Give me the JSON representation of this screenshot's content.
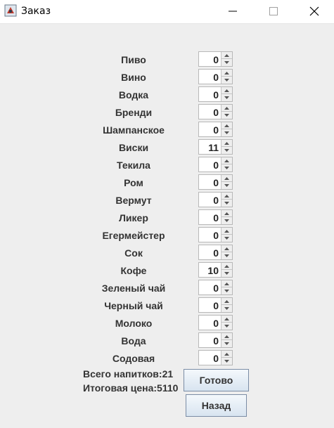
{
  "window": {
    "title": "Заказ"
  },
  "drinks": [
    {
      "label": "Пиво",
      "value": "0"
    },
    {
      "label": "Вино",
      "value": "0"
    },
    {
      "label": "Водка",
      "value": "0"
    },
    {
      "label": "Бренди",
      "value": "0"
    },
    {
      "label": "Шампанское",
      "value": "0"
    },
    {
      "label": "Виски",
      "value": "11"
    },
    {
      "label": "Текила",
      "value": "0"
    },
    {
      "label": "Ром",
      "value": "0"
    },
    {
      "label": "Вермут",
      "value": "0"
    },
    {
      "label": "Ликер",
      "value": "0"
    },
    {
      "label": "Егермейстер",
      "value": "0"
    },
    {
      "label": "Сок",
      "value": "0"
    },
    {
      "label": "Кофе",
      "value": "10"
    },
    {
      "label": "Зеленый чай",
      "value": "0"
    },
    {
      "label": "Черный чай",
      "value": "0"
    },
    {
      "label": "Молоко",
      "value": "0"
    },
    {
      "label": "Вода",
      "value": "0"
    },
    {
      "label": "Содовая",
      "value": "0"
    }
  ],
  "summary": {
    "total_drinks": "Всего напитков:21",
    "total_price": "Итоговая цена:5110"
  },
  "buttons": {
    "done": "Готово",
    "back": "Назад"
  }
}
